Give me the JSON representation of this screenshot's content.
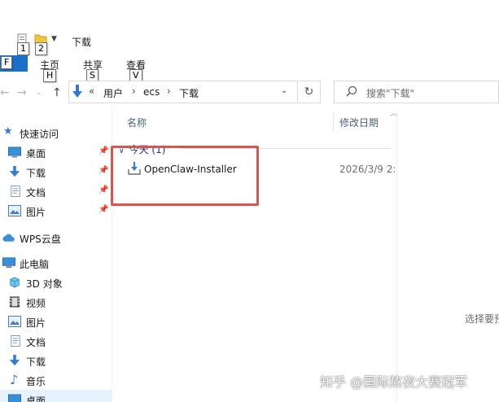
{
  "window": {
    "title": "下载"
  },
  "quick_access_toolbar": {
    "keytips": [
      "1",
      "2"
    ]
  },
  "ribbon": {
    "file_keytip": "F",
    "tabs": [
      {
        "label": "主页",
        "keytip": "H"
      },
      {
        "label": "共享",
        "keytip": "S"
      },
      {
        "label": "查看",
        "keytip": "V"
      }
    ]
  },
  "address_bar": {
    "overflow": "«",
    "crumbs": [
      "用户",
      "ecs",
      "下载"
    ],
    "separator": "›"
  },
  "search": {
    "placeholder": "搜索\"下载\""
  },
  "sidebar": {
    "quick_access": {
      "label": "快速访问",
      "items": [
        {
          "label": "桌面",
          "pinned": true
        },
        {
          "label": "下载",
          "pinned": true
        },
        {
          "label": "文档",
          "pinned": true
        },
        {
          "label": "图片",
          "pinned": true
        }
      ]
    },
    "wps": {
      "label": "WPS云盘"
    },
    "this_pc": {
      "label": "此电脑",
      "items": [
        {
          "label": "3D 对象"
        },
        {
          "label": "视频"
        },
        {
          "label": "图片"
        },
        {
          "label": "文档"
        },
        {
          "label": "下载"
        },
        {
          "label": "音乐"
        },
        {
          "label": "桌面"
        }
      ]
    }
  },
  "file_list": {
    "columns": {
      "name": "名称",
      "date_modified": "修改日期"
    },
    "groups": [
      {
        "label": "今天 (1)",
        "files": [
          {
            "name": "OpenClaw-Installer",
            "date": "2026/3/9 2:"
          }
        ]
      }
    ]
  },
  "preview_pane": {
    "hint": "选择要预"
  },
  "watermark": "知乎 @国际熬夜大赛冠军",
  "colors": {
    "accent": "#1a6fc9",
    "highlight_border": "#d9534f",
    "group_header": "#1e3287"
  }
}
